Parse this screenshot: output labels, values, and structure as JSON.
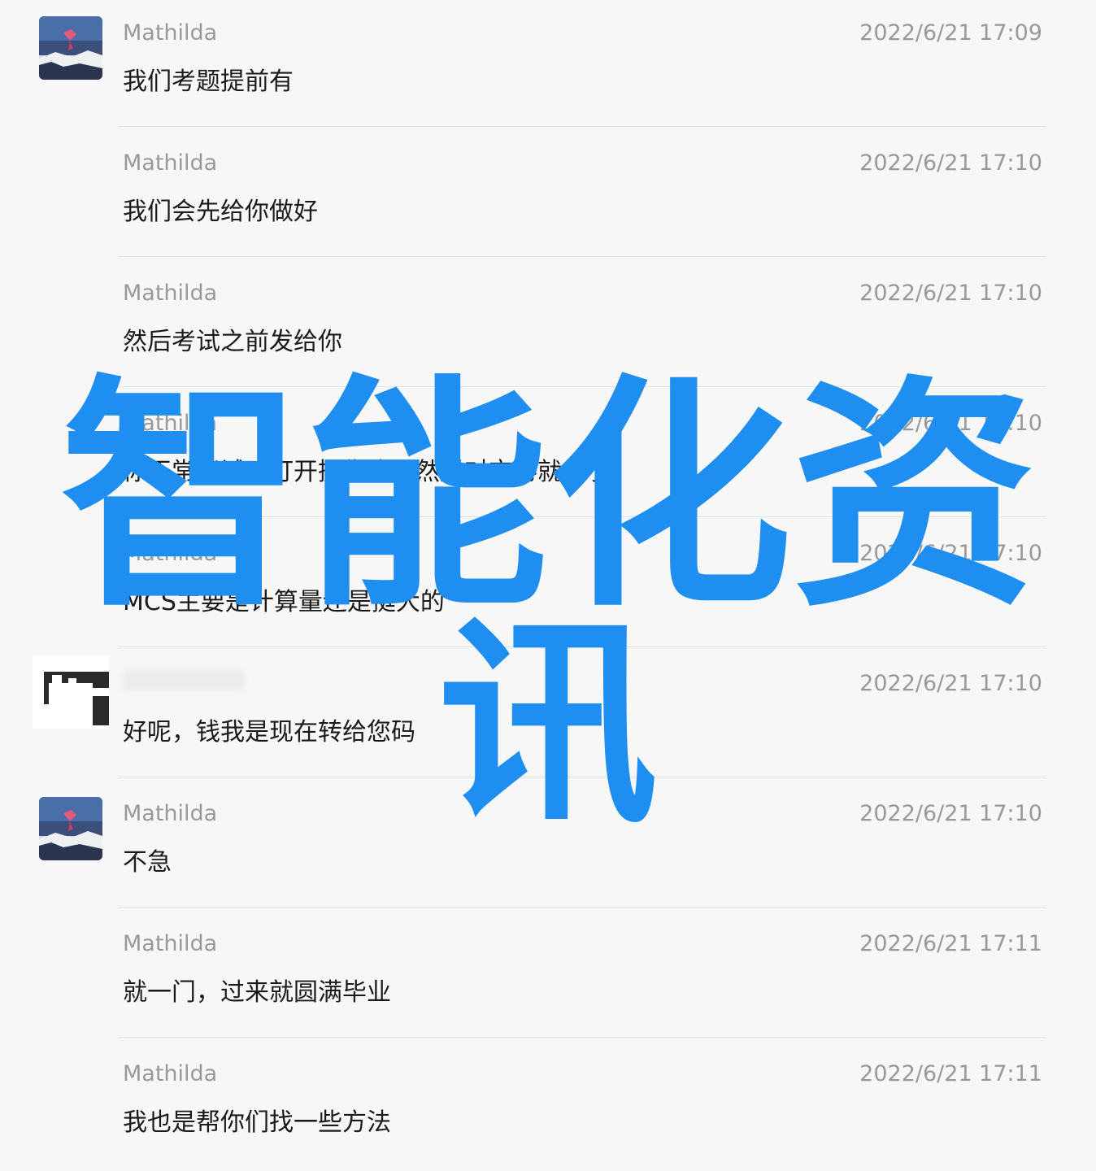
{
  "messages": [
    {
      "sender": "Mathilda",
      "time": "2022/6/21 17:09",
      "text": "我们考题提前有",
      "avatar": "photo-avatar"
    },
    {
      "sender": "Mathilda",
      "time": "2022/6/21 17:10",
      "text": "我们会先给你做好",
      "avatar": ""
    },
    {
      "sender": "Mathilda",
      "time": "2022/6/21 17:10",
      "text": "然后考试之前发给你",
      "avatar": ""
    },
    {
      "sender": "Mathilda",
      "time": "2022/6/21 17:10",
      "text": "你正常考试，打开摄像头，然后对交卷就行了",
      "avatar": ""
    },
    {
      "sender": "Mathilda",
      "time": "2022/6/21 17:10",
      "text": "MCS主要是计算量还是挺大的",
      "avatar": ""
    },
    {
      "sender": "",
      "time": "2022/6/21 17:10",
      "text": "好呢，钱我是现在转给您码",
      "avatar": "blurred-avatar"
    },
    {
      "sender": "Mathilda",
      "time": "2022/6/21 17:10",
      "text": "不急",
      "avatar": "photo-avatar"
    },
    {
      "sender": "Mathilda",
      "time": "2022/6/21 17:11",
      "text": "就一门，过来就圆满毕业",
      "avatar": ""
    },
    {
      "sender": "Mathilda",
      "time": "2022/6/21 17:11",
      "text": "我也是帮你们找一些方法",
      "avatar": ""
    }
  ],
  "watermark": {
    "line1": "智能化资",
    "line2": "讯",
    "color": "#1e8ef0"
  },
  "colors": {
    "background": "#f7f7f7",
    "meta_text": "#999999",
    "message_text": "#1a1a1a",
    "divider": "#e3e3e3"
  }
}
